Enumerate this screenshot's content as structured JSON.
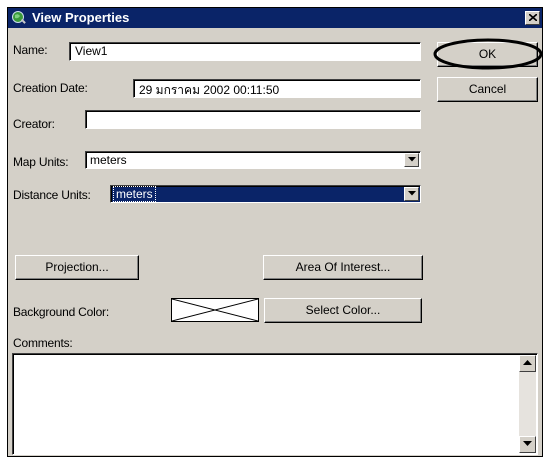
{
  "window": {
    "title": "View Properties",
    "app_icon": "globe-icon",
    "close_icon": "close-icon"
  },
  "form": {
    "name_label": "Name:",
    "name_value": "View1",
    "creation_date_label": "Creation Date:",
    "creation_date_value": "29 มกราคม 2002 00:11:50",
    "creator_label": "Creator:",
    "creator_value": "",
    "map_units_label": "Map Units:",
    "map_units_value": "meters",
    "distance_units_label": "Distance Units:",
    "distance_units_value": "meters",
    "background_color_label": "Background Color:",
    "comments_label": "Comments:",
    "comments_value": ""
  },
  "buttons": {
    "ok": "OK",
    "cancel": "Cancel",
    "projection": "Projection...",
    "area_of_interest": "Area Of Interest...",
    "select_color": "Select Color..."
  },
  "colors": {
    "titlebar": "#0a2468",
    "dialog_face": "#d4d0c8",
    "highlight_circle": "#000000"
  }
}
